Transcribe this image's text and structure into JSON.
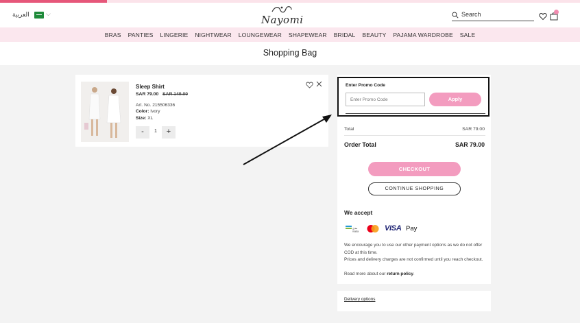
{
  "header": {
    "language_label": "العربية",
    "country_flag": "saudi-arabia-flag",
    "logo_text": "Nayomi",
    "search_label": "Search",
    "brand_color": "#e6577a"
  },
  "nav": {
    "items": [
      "BRAS",
      "PANTIES",
      "LINGERIE",
      "NIGHTWEAR",
      "LOUNGEWEAR",
      "SHAPEWEAR",
      "BRIDAL",
      "BEAUTY",
      "PAJAMA WARDROBE",
      "SALE"
    ]
  },
  "page": {
    "title": "Shopping Bag"
  },
  "cart_item": {
    "name": "Sleep Shirt",
    "price": "SAR 79.00",
    "old_price": "SAR 149.00",
    "article_label": "Art. No.",
    "article_no": "215506336",
    "color_label": "Color:",
    "color_value": "Ivory",
    "size_label": "Size:",
    "size_value": "XL",
    "qty_minus": "-",
    "qty": "1",
    "qty_plus": "+"
  },
  "promo": {
    "title": "Enter Promo Code",
    "placeholder": "Enter Promo Code",
    "apply_label": "Apply"
  },
  "summary": {
    "total_label": "Total",
    "total_value": "SAR 79.00",
    "order_total_label": "Order Total",
    "order_total_value": "SAR 79.00",
    "checkout_label": "CHECKOUT",
    "continue_label": "CONTINUE SHOPPING",
    "accent_color": "#f39cbf"
  },
  "payments": {
    "title": "We accept",
    "methods": [
      "mada",
      "mastercard",
      "VISA",
      "Pay"
    ],
    "note1": "We encourage you to use our other payment options as we do not offer COD at this time.",
    "note2": "Prices and delivery charges are not confirmed until you reach checkout.",
    "note3_prefix": "Read more about our",
    "note3_link": "return policy",
    "note3_suffix": "."
  },
  "delivery": {
    "link_label": "Delivery options"
  }
}
